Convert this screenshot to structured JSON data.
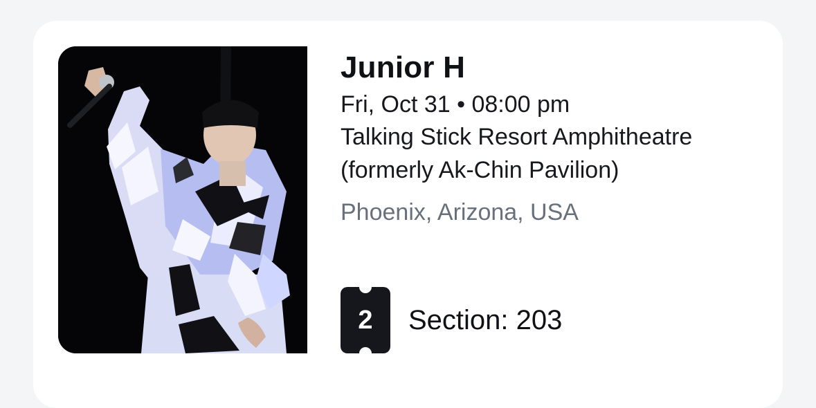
{
  "event": {
    "artist": "Junior H",
    "datetime": "Fri, Oct 31 • 08:00 pm",
    "venue": "Talking Stick Resort Amphitheatre (formerly Ak-Chin Pavilion)",
    "location": "Phoenix, Arizona, USA"
  },
  "ticket": {
    "quantity": "2",
    "section": "Section: 203"
  },
  "colors": {
    "background": "#f4f5f7",
    "card": "#ffffff",
    "primary_text": "#101114",
    "secondary_text": "#67707b",
    "ticket_badge": "#15171c"
  },
  "image": {
    "alt": "Junior H"
  }
}
